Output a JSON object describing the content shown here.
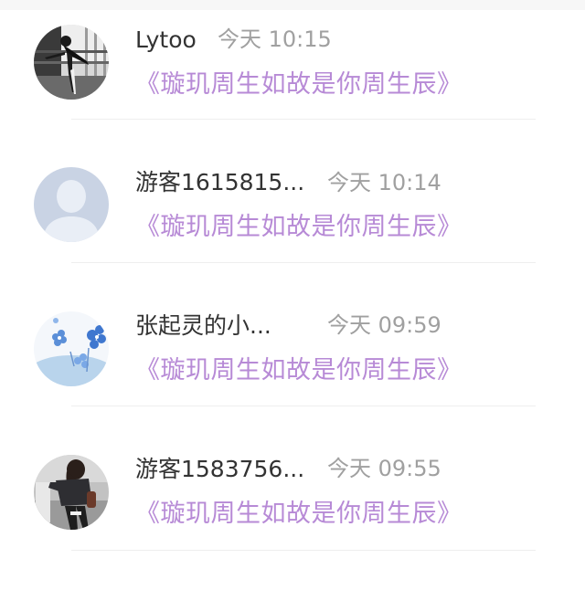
{
  "comments": [
    {
      "avatar": "dancer-photo-avatar",
      "name": "Lytoo",
      "time": "今天 10:15",
      "message": "《璇玑周生如故是你周生辰》"
    },
    {
      "avatar": "default-user-avatar",
      "name": "游客1615815...",
      "time": "今天 10:14",
      "message": "《璇玑周生如故是你周生辰》"
    },
    {
      "avatar": "blue-flowers-avatar",
      "name": "张起灵的小...",
      "time": "今天 09:59",
      "message": "《璇玑周生如故是你周生辰》"
    },
    {
      "avatar": "girl-photo-avatar",
      "name": "游客1583756...",
      "time": "今天 09:55",
      "message": "《璇玑周生如故是你周生辰》"
    }
  ],
  "colors": {
    "name": "#333333",
    "time": "#a0a0a0",
    "message": "#b78ad6",
    "divider": "#eeeeee"
  }
}
